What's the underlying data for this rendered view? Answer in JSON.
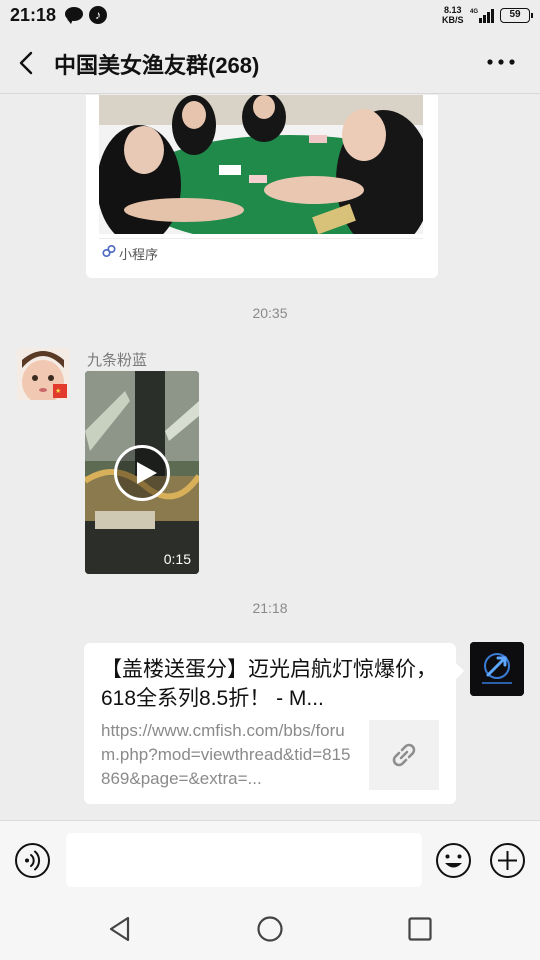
{
  "status_bar": {
    "time": "21:18",
    "net_speed_value": "8.13",
    "net_speed_unit": "KB/S",
    "network_type": "4G",
    "battery": "59"
  },
  "header": {
    "title": "中国美女渔友群(268)"
  },
  "messages": {
    "mini_program_label": "小程序",
    "timestamp_1": "20:35",
    "sender_name": "九条粉蓝",
    "video_duration": "0:15",
    "timestamp_2": "21:18",
    "link_title": "【盖楼送蛋分】迈光启航灯惊爆价，618全系列8.5折！ - M...",
    "link_url": "https://www.cmfish.com/bbs/forum.php?mod=viewthread&tid=815869&page=&extra=..."
  },
  "input": {
    "placeholder": ""
  },
  "icons": {
    "back": "back-icon",
    "more": "more-icon",
    "mini_program": "mini-program-icon",
    "play": "play-icon",
    "link": "link-icon",
    "voice": "voice-icon",
    "emoji": "emoji-icon",
    "plus": "plus-icon",
    "nav_back": "nav-back-icon",
    "nav_home": "nav-home-icon",
    "nav_recent": "nav-recent-icon"
  }
}
